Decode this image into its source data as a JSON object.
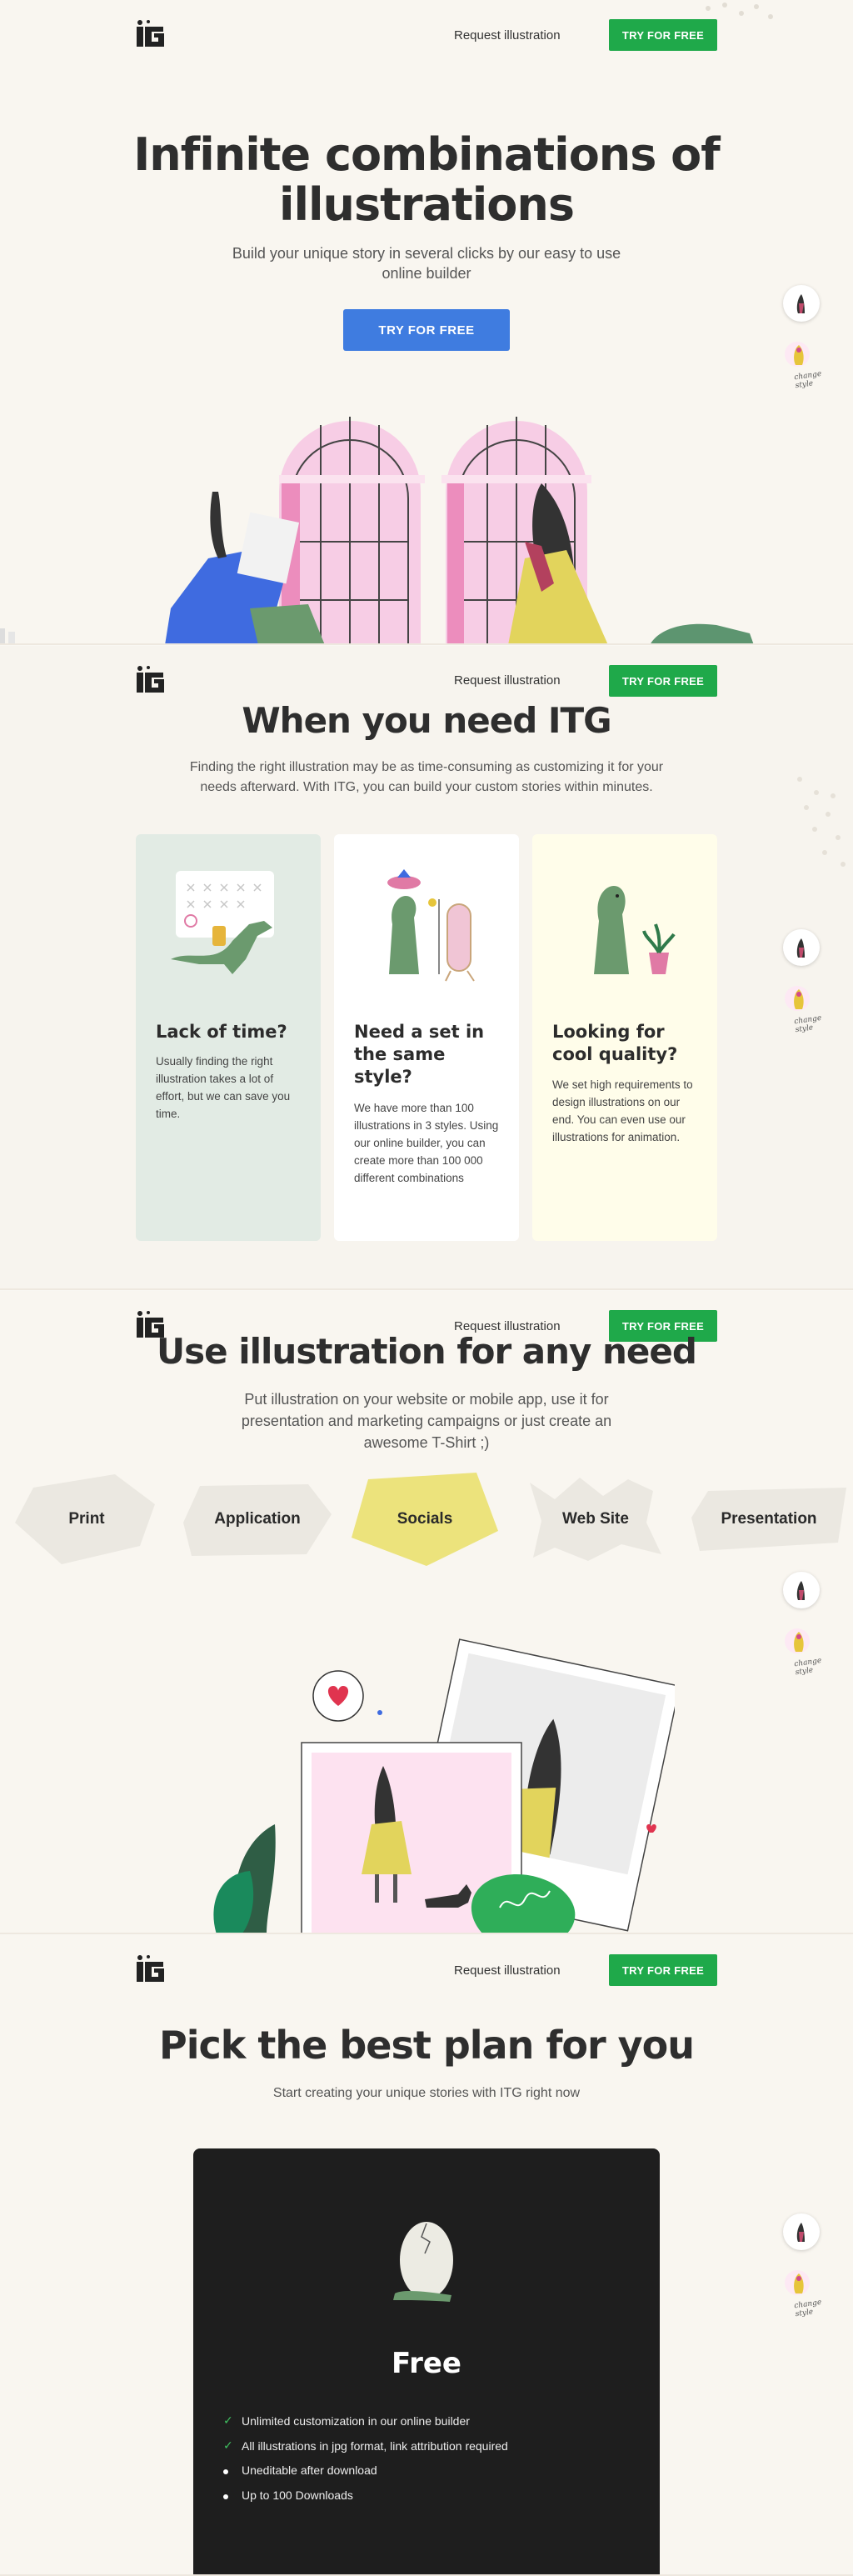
{
  "nav": {
    "request_label": "Request illustration",
    "try_label": "TRY FOR FREE"
  },
  "side": {
    "change_style": "change style"
  },
  "hero": {
    "title_line1": "Infinite combinations of",
    "title_line2": "illustrations",
    "subtitle_line1": "Build your unique story in several clicks by our easy to use",
    "subtitle_line2": "online builder",
    "cta_label": "TRY FOR FREE"
  },
  "need": {
    "title": "When you need ITG",
    "subtitle_line1": "Finding the right illustration may be as time-consuming as customizing it for your",
    "subtitle_line2": "needs afterward. With ITG, you can build your custom stories within minutes.",
    "cards": [
      {
        "title": "Lack of time?",
        "text": "Usually finding the right illustration takes a lot of effort, but we can save you time."
      },
      {
        "title": "Need a set in the same style?",
        "text": "We have more than 100 illustrations in 3 styles. Using our online builder, you can create more than 100 000 different combinations"
      },
      {
        "title": "Looking for cool quality?",
        "text": "We set high requirements to design illustrations on our end. You can even use our illustrations for animation."
      }
    ]
  },
  "use": {
    "title": "Use illustration for any need",
    "subtitle_line1": "Put illustration on your website or mobile app, use it for",
    "subtitle_line2": "presentation and marketing campaigns or just create an",
    "subtitle_line3": "awesome T-Shirt ;)",
    "pills": [
      "Print",
      "Application",
      "Socials",
      "Web Site",
      "Presentation"
    ]
  },
  "plans": {
    "title": "Pick the best plan for you",
    "subtitle": "Start creating your unique stories with ITG right now",
    "plan_name": "Free",
    "features": [
      "Unlimited customization in our online builder",
      "All illustrations in jpg format, link attribution required",
      "Uneditable after download",
      "Up to 100 Downloads"
    ]
  },
  "colors": {
    "accent_green": "#1fa94a",
    "cta_blue": "#3f7ce0",
    "card_mint": "#e2ebe4",
    "card_cream": "#fffdea",
    "socials_yellow": "#ece37c"
  }
}
